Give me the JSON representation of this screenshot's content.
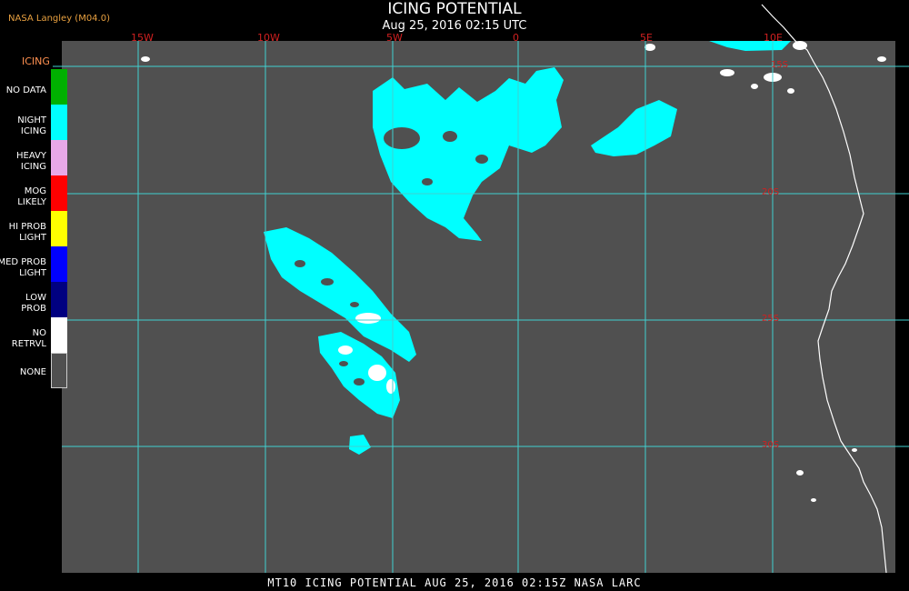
{
  "header": {
    "title": "ICING POTENTIAL",
    "subtitle": "Aug 25, 2016 02:15 UTC",
    "credit": "NASA Langley (M04.0)"
  },
  "map": {
    "longitude_labels": [
      "15W",
      "10W",
      "5W",
      "0",
      "5E",
      "10E"
    ],
    "latitude_labels": [
      "15S",
      "20S",
      "25S",
      "30S"
    ]
  },
  "legend": {
    "title": "ICING",
    "items": [
      {
        "label": "NO DATA",
        "color": "#00b000"
      },
      {
        "label": "NIGHT\nICING",
        "color": "#00ffff"
      },
      {
        "label": "HEAVY\nICING",
        "color": "#e8a8e8"
      },
      {
        "label": "MOG\nLIKELY",
        "color": "#ff0000"
      },
      {
        "label": "HI PROB\nLIGHT",
        "color": "#ffff00"
      },
      {
        "label": "MED PROB\nLIGHT",
        "color": "#0000ff"
      },
      {
        "label": "LOW\nPROB",
        "color": "#000080"
      },
      {
        "label": "NO\nRETRVL",
        "color": "#ffffff"
      },
      {
        "label": "NONE",
        "color": "#505050"
      }
    ]
  },
  "footer": "MT10  ICING POTENTIAL   AUG 25, 2016 02:15Z   NASA LARC",
  "colors": {
    "background": "#505050",
    "grid": "#40d0d0",
    "icing": "#00ffff",
    "no_retrieval": "#ffffff",
    "coastline": "#ffffff"
  }
}
